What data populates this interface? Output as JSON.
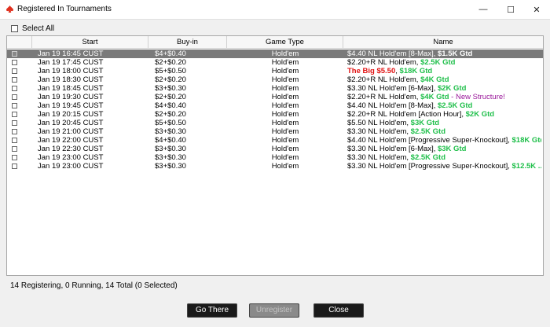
{
  "window": {
    "title": "Registered In Tournaments",
    "minimize": "—",
    "maximize": "☐",
    "close": "✕"
  },
  "select_all": {
    "label": "Select All"
  },
  "columns": [
    "Start",
    "Buy-in",
    "Game Type",
    "Name"
  ],
  "rows": [
    {
      "start": "Jan 19  16:45 CUST",
      "buyin": "$4+$0.40",
      "game": "Hold'em",
      "name": [
        {
          "t": "$4.40 NL Hold'em [8-Max], ",
          "c": ""
        },
        {
          "t": "$1.5K Gtd",
          "c": "green"
        }
      ]
    },
    {
      "start": "Jan 19  17:45 CUST",
      "buyin": "$2+$0.20",
      "game": "Hold'em",
      "name": [
        {
          "t": "$2.20+R NL Hold'em, ",
          "c": ""
        },
        {
          "t": "$2.5K Gtd",
          "c": "green"
        }
      ]
    },
    {
      "start": "Jan 19  18:00 CUST",
      "buyin": "$5+$0.50",
      "game": "Hold'em",
      "name": [
        {
          "t": "The Big $5.50",
          "c": "red"
        },
        {
          "t": ", ",
          "c": ""
        },
        {
          "t": "$18K Gtd",
          "c": "green"
        }
      ]
    },
    {
      "start": "Jan 19  18:30 CUST",
      "buyin": "$2+$0.20",
      "game": "Hold'em",
      "name": [
        {
          "t": "$2.20+R NL Hold'em, ",
          "c": ""
        },
        {
          "t": "$4K Gtd",
          "c": "green"
        }
      ]
    },
    {
      "start": "Jan 19  18:45 CUST",
      "buyin": "$3+$0.30",
      "game": "Hold'em",
      "name": [
        {
          "t": "$3.30 NL Hold'em [6-Max], ",
          "c": ""
        },
        {
          "t": "$2K Gtd",
          "c": "green"
        }
      ]
    },
    {
      "start": "Jan 19  19:30 CUST",
      "buyin": "$2+$0.20",
      "game": "Hold'em",
      "name": [
        {
          "t": "$2.20+R NL Hold'em, ",
          "c": ""
        },
        {
          "t": "$4K Gtd",
          "c": "green"
        },
        {
          "t": " - New Structure!",
          "c": "purple"
        }
      ]
    },
    {
      "start": "Jan 19  19:45 CUST",
      "buyin": "$4+$0.40",
      "game": "Hold'em",
      "name": [
        {
          "t": "$4.40 NL Hold'em [8-Max], ",
          "c": ""
        },
        {
          "t": "$2.5K Gtd",
          "c": "green"
        }
      ]
    },
    {
      "start": "Jan 19  20:15 CUST",
      "buyin": "$2+$0.20",
      "game": "Hold'em",
      "name": [
        {
          "t": "$2.20+R NL Hold'em [Action Hour], ",
          "c": ""
        },
        {
          "t": "$2K Gtd",
          "c": "green"
        }
      ]
    },
    {
      "start": "Jan 19  20:45 CUST",
      "buyin": "$5+$0.50",
      "game": "Hold'em",
      "name": [
        {
          "t": "$5.50 NL Hold'em, ",
          "c": ""
        },
        {
          "t": "$3K Gtd",
          "c": "green"
        }
      ]
    },
    {
      "start": "Jan 19  21:00 CUST",
      "buyin": "$3+$0.30",
      "game": "Hold'em",
      "name": [
        {
          "t": "$3.30 NL Hold'em, ",
          "c": ""
        },
        {
          "t": "$2.5K Gtd",
          "c": "green"
        }
      ]
    },
    {
      "start": "Jan 19  22:00 CUST",
      "buyin": "$4+$0.40",
      "game": "Hold'em",
      "name": [
        {
          "t": "$4.40 NL Hold'em [Progressive Super-Knockout], ",
          "c": ""
        },
        {
          "t": "$18K Gtd",
          "c": "green"
        }
      ]
    },
    {
      "start": "Jan 19  22:30 CUST",
      "buyin": "$3+$0.30",
      "game": "Hold'em",
      "name": [
        {
          "t": "$3.30 NL Hold'em [6-Max], ",
          "c": ""
        },
        {
          "t": "$3K Gtd",
          "c": "green"
        }
      ]
    },
    {
      "start": "Jan 19  23:00 CUST",
      "buyin": "$3+$0.30",
      "game": "Hold'em",
      "name": [
        {
          "t": "$3.30 NL Hold'em, ",
          "c": ""
        },
        {
          "t": "$2.5K Gtd",
          "c": "green"
        }
      ]
    },
    {
      "start": "Jan 19  23:00 CUST",
      "buyin": "$3+$0.30",
      "game": "Hold'em",
      "name": [
        {
          "t": "$3.30 NL Hold'em [Progressive Super-Knockout], ",
          "c": ""
        },
        {
          "t": "$12.5K ...",
          "c": "green"
        }
      ]
    }
  ],
  "selected_row": 0,
  "status": "14 Registering, 0 Running, 14 Total (0 Selected)",
  "buttons": {
    "go_there": "Go There",
    "unregister": "Unregister",
    "close": "Close"
  }
}
